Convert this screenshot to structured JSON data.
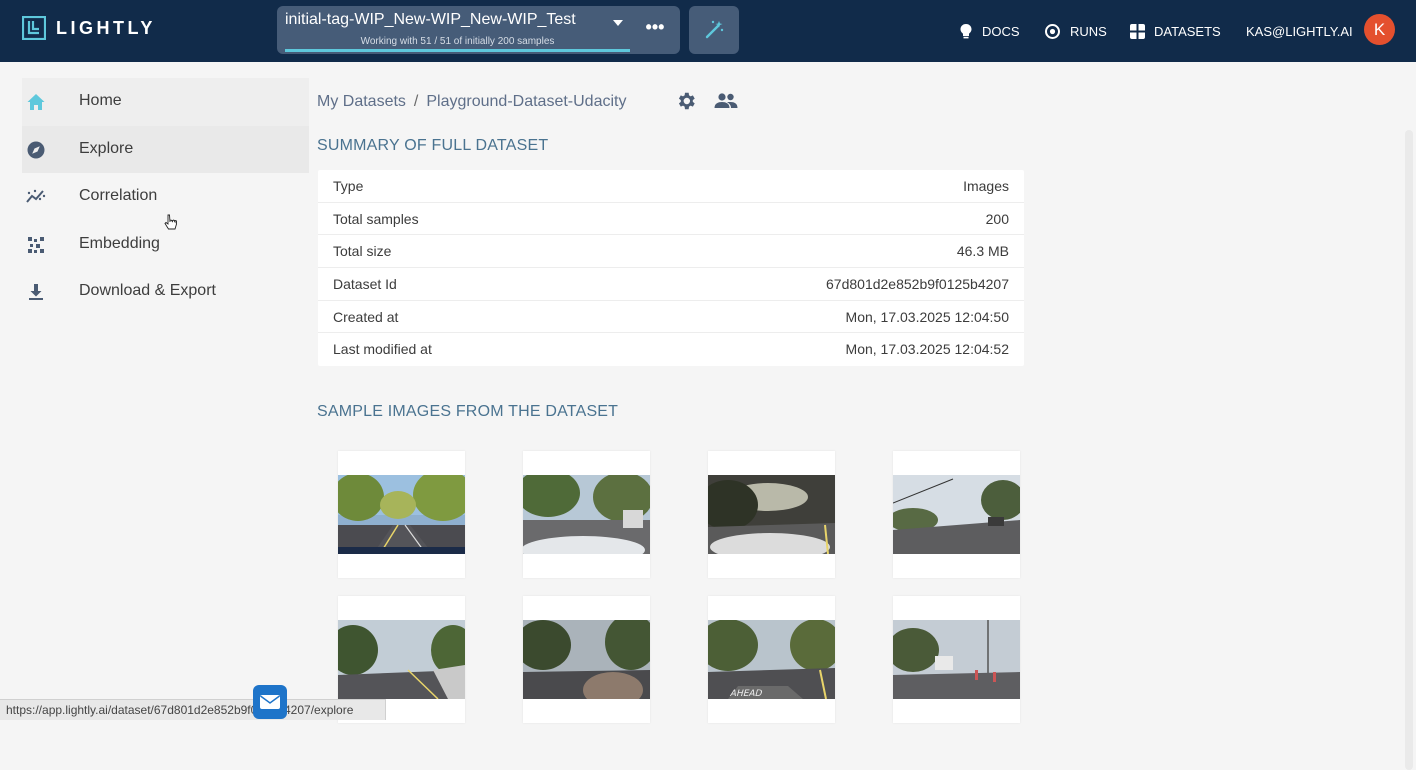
{
  "app": {
    "logo_text": "LIGHTLY"
  },
  "tag_selector": {
    "name": "initial-tag-WIP_New-WIP_New-WIP_Test",
    "subtitle": "Working with 51 / 51 of initially 200 samples",
    "progress": 1.0,
    "more_label": "•••"
  },
  "nav": {
    "docs": "DOCS",
    "runs": "RUNS",
    "datasets": "DATASETS",
    "user": "KAS@LIGHTLY.AI",
    "avatar_initial": "K"
  },
  "sidebar": {
    "items": [
      {
        "label": "Home",
        "icon": "home-icon"
      },
      {
        "label": "Explore",
        "icon": "compass-icon"
      },
      {
        "label": "Correlation",
        "icon": "correlation-icon"
      },
      {
        "label": "Embedding",
        "icon": "embedding-icon"
      },
      {
        "label": "Download & Export",
        "icon": "download-icon"
      }
    ]
  },
  "breadcrumb": {
    "root": "My Datasets",
    "separator": "/",
    "current": "Playground-Dataset-Udacity"
  },
  "summary": {
    "title": "SUMMARY OF FULL DATASET",
    "rows": [
      {
        "key": "Type",
        "value": "Images"
      },
      {
        "key": "Total samples",
        "value": "200"
      },
      {
        "key": "Total size",
        "value": "46.3 MB"
      },
      {
        "key": "Dataset Id",
        "value": "67d801d2e852b9f0125b4207"
      },
      {
        "key": "Created at",
        "value": "Mon, 17.03.2025 12:04:50"
      },
      {
        "key": "Last modified at",
        "value": "Mon, 17.03.2025 12:04:52"
      }
    ]
  },
  "samples": {
    "title": "SAMPLE IMAGES FROM THE DATASET"
  },
  "status_bar": {
    "url": "https://app.lightly.ai/dataset/67d801d2e852b9f0125b4207/explore"
  },
  "colors": {
    "topbar": "#112b4a",
    "accent": "#5ec8dc",
    "section_title": "#4a7390",
    "avatar": "#e4502e"
  }
}
